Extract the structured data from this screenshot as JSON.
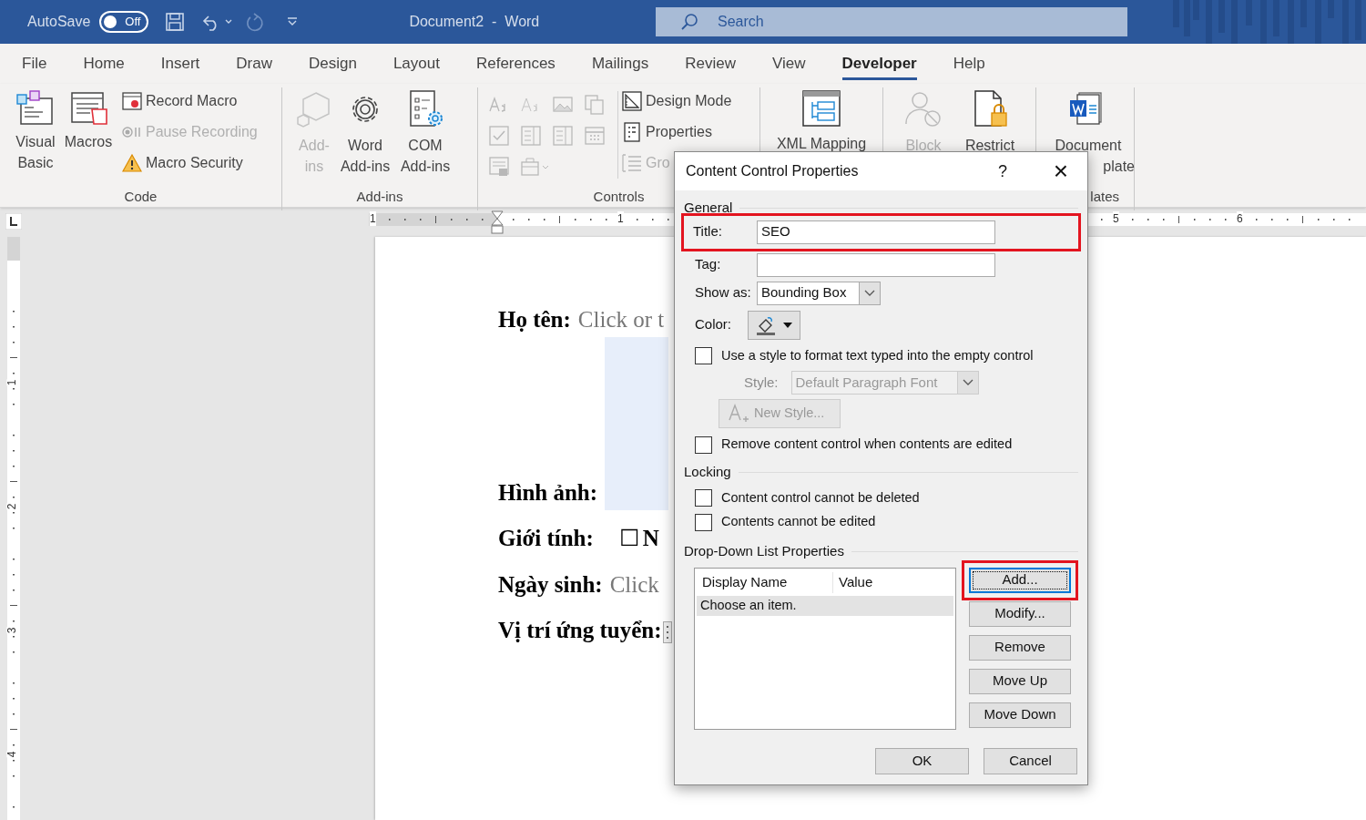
{
  "title_bar": {
    "autosave_label": "AutoSave",
    "autosave_toggle": {
      "label": "Off",
      "on": false
    },
    "document_title": "Document2  -  Word",
    "search": {
      "placeholder": "Search"
    }
  },
  "tabs": [
    {
      "label": "File",
      "selected": false
    },
    {
      "label": "Home",
      "selected": false
    },
    {
      "label": "Insert",
      "selected": false
    },
    {
      "label": "Draw",
      "selected": false
    },
    {
      "label": "Design",
      "selected": false
    },
    {
      "label": "Layout",
      "selected": false
    },
    {
      "label": "References",
      "selected": false
    },
    {
      "label": "Mailings",
      "selected": false
    },
    {
      "label": "Review",
      "selected": false
    },
    {
      "label": "View",
      "selected": false
    },
    {
      "label": "Developer",
      "selected": true
    },
    {
      "label": "Help",
      "selected": false
    }
  ],
  "ribbon": {
    "code": {
      "label": "Code",
      "large": [
        {
          "label": "Visual Basic",
          "disabled": false
        },
        {
          "label": "Macros",
          "disabled": false
        }
      ],
      "small": [
        {
          "label": "Record Macro",
          "disabled": false
        },
        {
          "label": "Pause Recording",
          "disabled": true
        },
        {
          "label": "Macro Security",
          "disabled": false
        }
      ]
    },
    "add_ins": {
      "label": "Add-ins",
      "large": [
        {
          "label": "Add-ins",
          "disabled": true
        },
        {
          "label": "Word Add-ins",
          "disabled": false
        },
        {
          "label": "COM Add-ins",
          "disabled": false
        }
      ]
    },
    "controls": {
      "label": "Controls",
      "small": [
        {
          "label": "Design Mode",
          "disabled": false
        },
        {
          "label": "Properties",
          "disabled": false
        },
        {
          "label": "Gro",
          "disabled": true
        }
      ]
    },
    "mapping": {
      "large": [
        {
          "label": "XML Mapping",
          "disabled": false
        }
      ]
    },
    "protect": {
      "large": [
        {
          "label": "Block",
          "disabled": true
        },
        {
          "label": "Restrict",
          "disabled": false
        }
      ]
    },
    "templates": {
      "label": "lates",
      "large": [
        {
          "label": "Document",
          "label_line_2": "plate",
          "disabled": false
        }
      ]
    }
  },
  "rulers": {
    "horizontal": [
      "1",
      "1",
      "5",
      "6"
    ],
    "vertical": [
      "1",
      "2",
      "3",
      "4"
    ]
  },
  "document": {
    "fields": [
      {
        "kind": "text",
        "label": "Họ tên:",
        "value": "Click or t"
      },
      {
        "kind": "picture",
        "label": "Hình ảnh:"
      },
      {
        "kind": "checkbox",
        "label": "Giới tính:",
        "box": "☐",
        "value": "N"
      },
      {
        "kind": "text",
        "label": "Ngày sinh:",
        "value": "Click"
      },
      {
        "kind": "dropdown",
        "label": "Vị trí ứng tuyển:"
      }
    ]
  },
  "dialog": {
    "title": "Content Control Properties",
    "help": "?",
    "close": "×",
    "general": {
      "heading": "General",
      "title_field": {
        "label": "Title:",
        "value": "SEO",
        "highlighted": true
      },
      "tag_field": {
        "label": "Tag:"
      },
      "show_as": {
        "label": "Show as:",
        "value": "Bounding Box"
      },
      "color": {
        "label": "Color:"
      },
      "use_style": {
        "label": "Use a style to format text typed into the empty control",
        "checked": false
      },
      "style": {
        "label": "Style:",
        "value": "Default Paragraph Font",
        "disabled": true
      },
      "new_style": {
        "label": "New Style...",
        "disabled": true
      },
      "remove_when_edited": {
        "label": "Remove content control when contents are edited",
        "checked": false
      }
    },
    "locking": {
      "heading": "Locking",
      "options": [
        {
          "label": "Content control cannot be deleted",
          "checked": false
        },
        {
          "label": "Contents cannot be edited",
          "checked": false
        }
      ]
    },
    "dropdown_list": {
      "heading": "Drop-Down List Properties",
      "columns": [
        "Display Name",
        "Value"
      ],
      "rows": [
        {
          "display_name": "Choose an item.",
          "selected": true
        }
      ],
      "buttons": [
        {
          "label": "Add...",
          "focused": true,
          "highlighted": true
        },
        {
          "label": "Modify...",
          "focused": false,
          "highlighted": false
        },
        {
          "label": "Remove",
          "focused": false,
          "highlighted": false
        },
        {
          "label": "Move Up",
          "focused": false,
          "highlighted": false
        },
        {
          "label": "Move Down",
          "focused": false,
          "highlighted": false
        }
      ]
    },
    "footer_buttons": [
      "OK",
      "Cancel"
    ]
  }
}
